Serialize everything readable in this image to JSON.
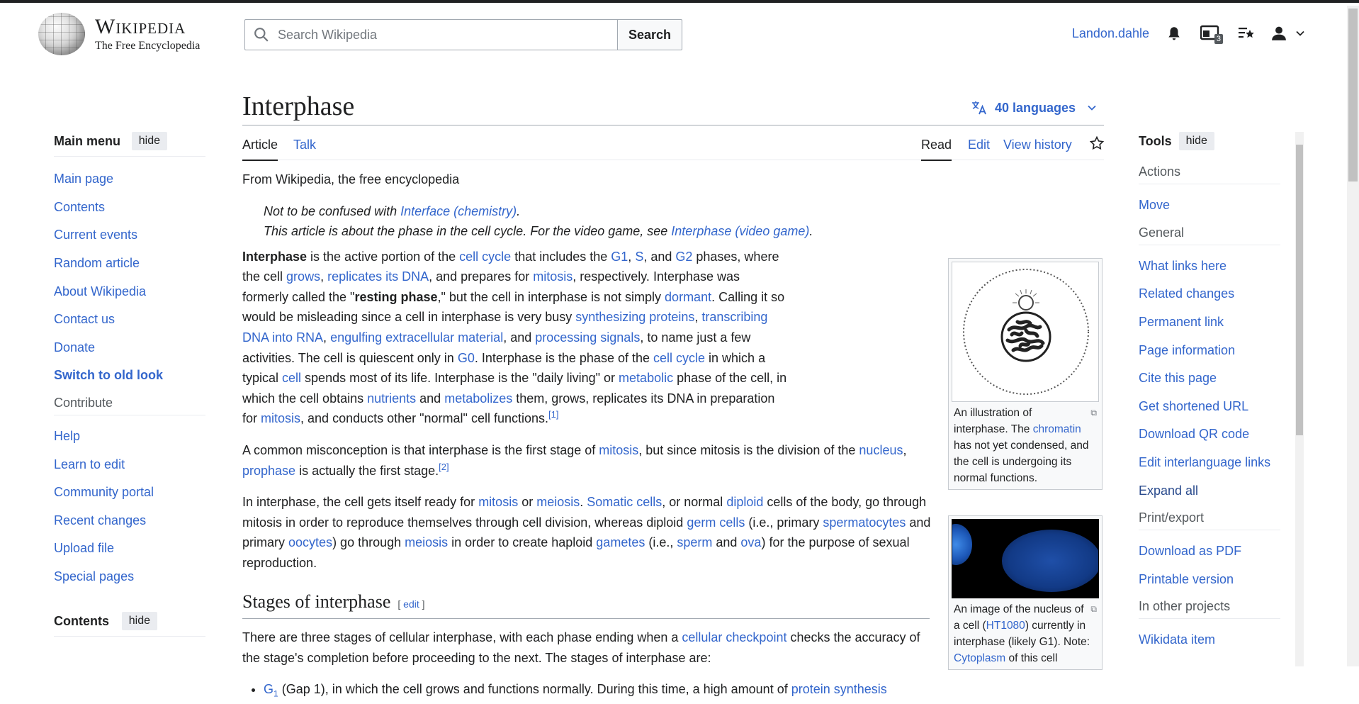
{
  "header": {
    "wordmark_title": "Wikipedia",
    "wordmark_tagline": "The Free Encyclopedia",
    "search_placeholder": "Search Wikipedia",
    "search_button": "Search",
    "username": "Landon.dahle",
    "notices_badge": "3"
  },
  "main_menu": {
    "title": "Main menu",
    "hide": "hide",
    "items": [
      "Main page",
      "Contents",
      "Current events",
      "Random article",
      "About Wikipedia",
      "Contact us",
      "Donate",
      "Switch to old look"
    ],
    "contribute_heading": "Contribute",
    "contribute_items": [
      "Help",
      "Learn to edit",
      "Community portal",
      "Recent changes",
      "Upload file",
      "Special pages"
    ]
  },
  "contents_box": {
    "title": "Contents",
    "hide": "hide"
  },
  "tools": {
    "title": "Tools",
    "hide": "hide",
    "actions_heading": "Actions",
    "actions": [
      "Move"
    ],
    "general_heading": "General",
    "general": [
      "What links here",
      "Related changes",
      "Permanent link",
      "Page information",
      "Cite this page",
      "Get shortened URL",
      "Download QR code",
      "Edit interlanguage links",
      "Expand all"
    ],
    "print_heading": "Print/export",
    "print": [
      "Download as PDF",
      "Printable version"
    ],
    "other_heading": "In other projects",
    "other": [
      "Wikidata item"
    ]
  },
  "article": {
    "title": "Interphase",
    "languages": "40 languages",
    "tabs": {
      "article": "Article",
      "talk": "Talk",
      "read": "Read",
      "edit": "Edit",
      "history": "View history"
    },
    "tagline": "From Wikipedia, the free encyclopedia",
    "hatnote1": {
      "pre": "Not to be confused with ",
      "link": "Interface (chemistry)",
      "post": "."
    },
    "hatnote2": {
      "pre": "This article is about the phase in the cell cycle. For the video game, see ",
      "link": "Interphase (video game)",
      "post": "."
    },
    "section_title": "Stages of interphase",
    "section_edit": "edit",
    "stages_intro_pre": "There are three stages of cellular interphase, with each phase ending when a ",
    "stages_intro_link": "cellular checkpoint",
    "stages_intro_post": " checks the accuracy of the stage's completion before proceeding to the next. The stages of interphase are:",
    "list_item_link": "G",
    "list_item_sub": "1",
    "list_item_text": " (Gap 1), in which the cell grows and functions normally. During this time, a high amount of ",
    "list_item_link2": "protein synthesis"
  },
  "thumbs": {
    "one": {
      "cap_pre": "An illustration of interphase. The ",
      "cap_link": "chromatin",
      "cap_post": " has not yet condensed, and the cell is undergoing its normal functions."
    },
    "two": {
      "cap_pre": "An image of the nucleus of a cell (",
      "cap_link": "HT1080",
      "cap_mid": ") currently in interphase (likely G1). Note: ",
      "cap_link2": "Cytoplasm",
      "cap_post": " of this cell"
    }
  }
}
